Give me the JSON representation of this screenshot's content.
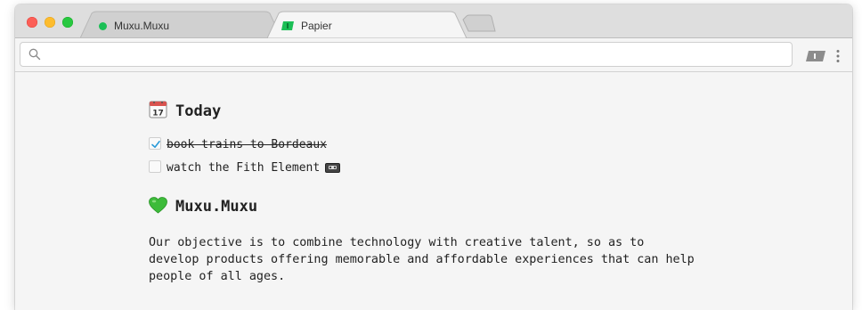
{
  "tabs": [
    {
      "label": "Muxu.Muxu",
      "icon": "green-dot-icon",
      "active": false
    },
    {
      "label": "Papier",
      "icon": "papier-icon",
      "active": true
    }
  ],
  "omnibox": {
    "value": "",
    "placeholder": ""
  },
  "today": {
    "emoji": "calendar-icon",
    "title": "Today",
    "todos": [
      {
        "label": "book trains to Bordeaux",
        "checked": true
      },
      {
        "label": "watch the Fith Element",
        "checked": false,
        "suffix_icon": "videocassette-icon"
      }
    ]
  },
  "section": {
    "emoji": "green-heart-icon",
    "title": "Muxu.Muxu",
    "paragraph": "Our objective is to combine technology with creative talent, so as to\ndevelop products offering memorable and affordable experiences that can help\npeople of all ages."
  },
  "colors": {
    "accent_green": "#1bbf56",
    "checkbox_check": "#2a9ad8",
    "window_bg": "#f5f5f5",
    "titlebar_bg": "#dedede"
  }
}
